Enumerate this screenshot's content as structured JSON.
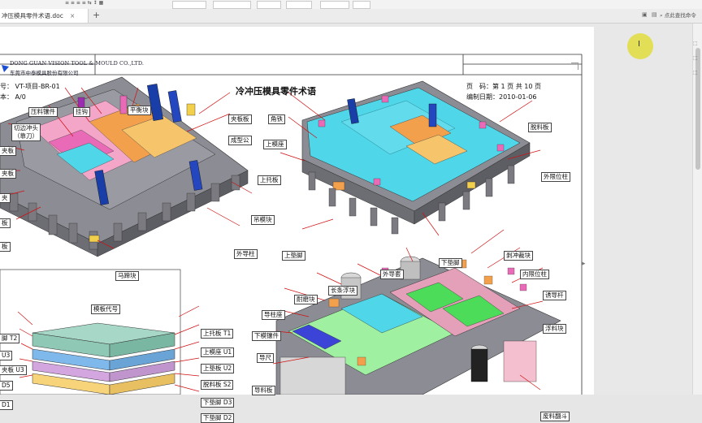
{
  "tab": {
    "title": "冲压模具零件术语.doc",
    "close": "×",
    "new": "+"
  },
  "search": {
    "placeholder": "点此查找命令"
  },
  "header": {
    "company_en": "DONG GUAN VISION TOOL & MOULD CO.,LTD.",
    "company_cn": "东莞市中泰模具股份有限公司",
    "doc_no": "VT-项目-BR-01",
    "version": "A/0",
    "title": "冷冲压模具零件术语",
    "page_label": "页　码：第 1 页 共 10 页",
    "date_label": "编制日期：2010-01-06"
  },
  "left_header_labels": {
    "doc": "号：",
    "ver": "本："
  },
  "labels": [
    "压料镶件",
    "挂钩",
    "平衡块",
    "切边冲头",
    "（靠刀）",
    "夹板板",
    "成型公",
    "角铁",
    "上模座",
    "上托板",
    "脱料板",
    "外限位柱",
    "吊模块",
    "外导柱",
    "上垫脚",
    "下垫脚",
    "马蹄块",
    "剥冲裁块",
    "内限位柱",
    "外导套",
    "长条浮块",
    "耐磨块",
    "导柱座",
    "下模镶件",
    "导尺",
    "导料板",
    "诱导杆",
    "浮料块",
    "废料翻斗"
  ],
  "left_edge_labels": [
    "夹板",
    "夹板",
    "夹",
    "板",
    "板"
  ],
  "plate_table": {
    "title": "模板代号",
    "rows": [
      {
        "name": "上托板",
        "code": "T1"
      },
      {
        "name": "上模座",
        "code": "U1"
      },
      {
        "name": "上垫板",
        "code": "U2"
      },
      {
        "name": "脱料板",
        "code": "S2"
      },
      {
        "name": "下垫脚",
        "code": "D3"
      },
      {
        "name": "下垫脚",
        "code": "D2"
      }
    ],
    "left_rows": [
      {
        "name": "脚",
        "code": "T2"
      },
      {
        "name": "",
        "code": "U3"
      },
      {
        "name": "夹板",
        "code": "U3"
      },
      {
        "name": "",
        "code": "D5"
      },
      {
        "name": "",
        "code": "D1"
      }
    ]
  },
  "colors": {
    "accent": "#1a4fd1",
    "cyan": "#4fd6e8",
    "pink": "#f0a2c4",
    "orange": "#f2a04c",
    "green": "#4ddc5a",
    "base": "#7d7d85"
  }
}
